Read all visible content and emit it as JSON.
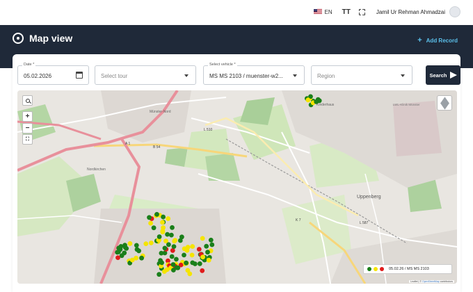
{
  "topbar": {
    "language": "EN",
    "text_size_icon": "TT",
    "user_name": "Jamil Ur Rehman Ahmadzai"
  },
  "header": {
    "title": "Map view",
    "add_record": "Add Record"
  },
  "filters": {
    "date": {
      "label": "Date *",
      "value": "05.02.2026"
    },
    "tour": {
      "placeholder": "Select tour"
    },
    "vehicle": {
      "label": "Select vehicle *",
      "value": "MS MS 2103 / muenster-w2..."
    },
    "region": {
      "placeholder": "Region"
    },
    "search_label": "Search"
  },
  "map": {
    "labels": [
      {
        "text": "Münster-Nord"
      },
      {
        "text": "Nordkirchen"
      },
      {
        "text": "Uppenberg"
      },
      {
        "text": "A 1"
      },
      {
        "text": "B 54"
      },
      {
        "text": "L 510"
      },
      {
        "text": "L 587"
      },
      {
        "text": "K 7"
      },
      {
        "text": "LWL-Klinik Münster"
      },
      {
        "text": "Kinderhaus"
      }
    ],
    "legend_text": "05.02.26 / MS MS 2103",
    "attribution_prefix": "Leaflet | ©",
    "attribution_link": "OpenStreetMap",
    "attribution_suffix": "contributors",
    "point_colors": {
      "green": "#1a7f1a",
      "yellow": "#f5e400",
      "red": "#e01b1b"
    }
  }
}
